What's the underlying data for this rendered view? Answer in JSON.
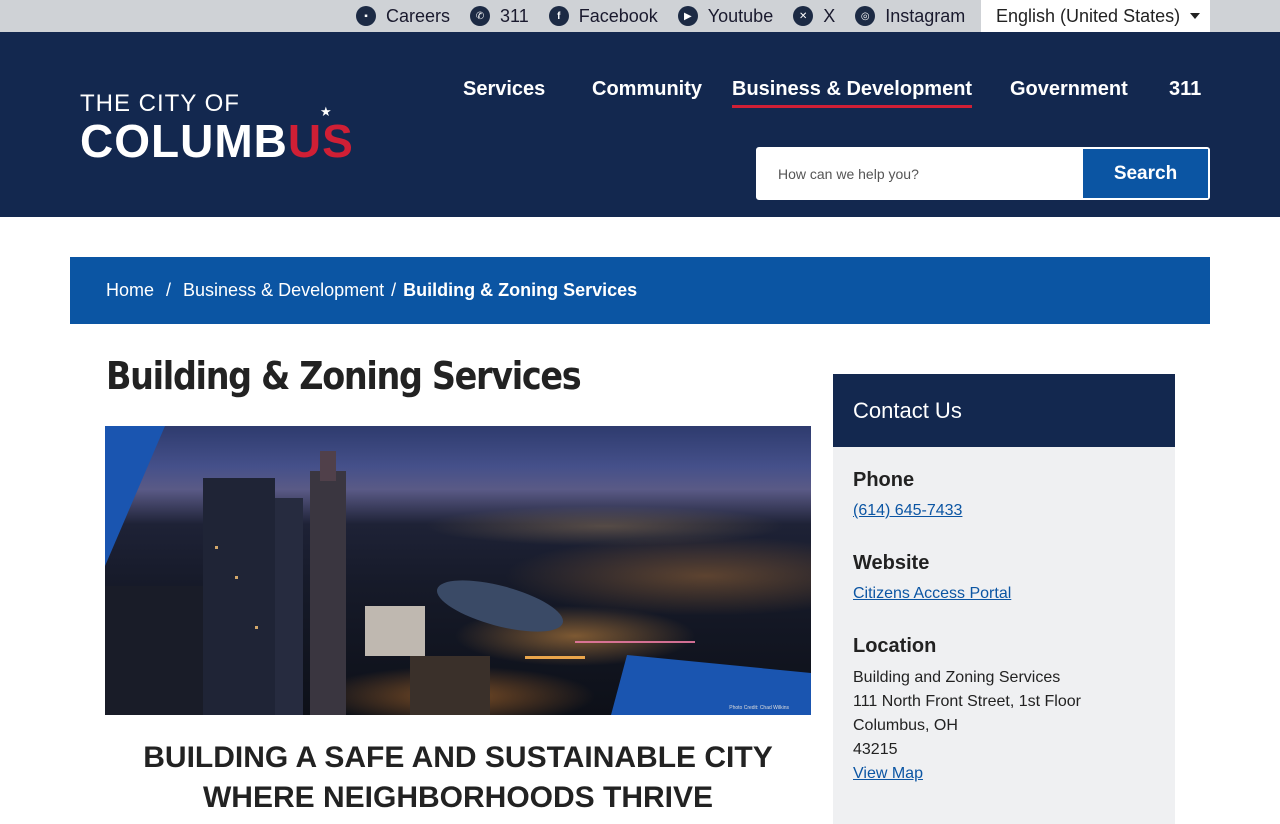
{
  "utility": {
    "links": [
      {
        "label": "Careers",
        "icon": "briefcase-icon"
      },
      {
        "label": "311",
        "icon": "phone-icon"
      },
      {
        "label": "Facebook",
        "icon": "facebook-icon"
      },
      {
        "label": "Youtube",
        "icon": "youtube-icon"
      },
      {
        "label": "X",
        "icon": "x-icon"
      },
      {
        "label": "Instagram",
        "icon": "instagram-icon"
      }
    ],
    "language": "English (United States)"
  },
  "logo": {
    "line1": "THE CITY OF",
    "line2a": "COLUMB",
    "line2b": "US"
  },
  "nav": {
    "items": [
      "Services",
      "Community",
      "Business & Development",
      "Government",
      "311"
    ],
    "active": "Business & Development"
  },
  "search": {
    "placeholder": "How can we help you?",
    "button": "Search"
  },
  "breadcrumb": {
    "home": "Home",
    "parent": "Business & Development",
    "current": "Building & Zoning Services",
    "separator": "/"
  },
  "page": {
    "title": "Building & Zoning Services",
    "photo_credit": "Photo Credit: Chad Wilkins",
    "tagline": "BUILDING A SAFE AND SUSTAINABLE CITY WHERE NEIGHBORHOODS THRIVE"
  },
  "contact": {
    "title": "Contact Us",
    "phone_heading": "Phone",
    "phone": "(614) 645-7433",
    "website_heading": "Website",
    "website_link": "Citizens Access Portal",
    "location_heading": "Location",
    "location_lines": [
      "Building and Zoning Services",
      "111 North Front Street, 1st Floor",
      "Columbus, OH",
      "43215"
    ],
    "map_link": "View Map"
  },
  "colors": {
    "navy": "#13284f",
    "blue": "#0b55a3",
    "red": "#d01f35"
  }
}
